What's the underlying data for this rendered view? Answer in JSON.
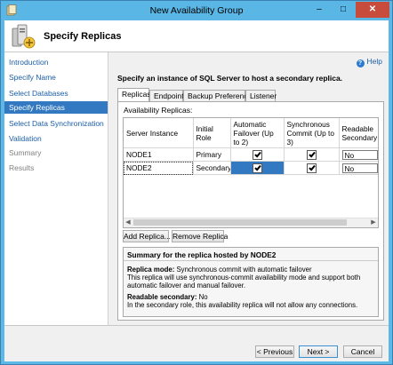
{
  "window": {
    "title": "New Availability Group",
    "minimize": "–",
    "maximize": "□",
    "close": "✕"
  },
  "header": {
    "title": "Specify Replicas"
  },
  "nav": {
    "items": [
      {
        "label": "Introduction",
        "state": "link"
      },
      {
        "label": "Specify Name",
        "state": "link"
      },
      {
        "label": "Select Databases",
        "state": "link"
      },
      {
        "label": "Specify Replicas",
        "state": "selected"
      },
      {
        "label": "Select Data Synchronization",
        "state": "link"
      },
      {
        "label": "Validation",
        "state": "link"
      },
      {
        "label": "Summary",
        "state": "disabled"
      },
      {
        "label": "Results",
        "state": "disabled"
      }
    ]
  },
  "content": {
    "help_label": "Help",
    "instruction": "Specify an instance of SQL Server to host a secondary replica.",
    "tabs": [
      "Replicas",
      "Endpoints",
      "Backup Preferences",
      "Listener"
    ],
    "active_tab": "Replicas",
    "panel_label": "Availability Replicas:",
    "table": {
      "headers": [
        "Server Instance",
        "Initial Role",
        "Automatic Failover (Up to 2)",
        "Synchronous Commit (Up to 3)",
        "Readable Secondary"
      ],
      "rows": [
        {
          "server": "NODE1",
          "role": "Primary",
          "auto_failover": true,
          "sync_commit": true,
          "readable": "No"
        },
        {
          "server": "NODE2",
          "role": "Secondary",
          "auto_failover": true,
          "sync_commit": true,
          "readable": "No"
        }
      ],
      "selected_row": 1
    },
    "buttons": {
      "add_replica": "Add Replica...",
      "remove_replica": "Remove Replica"
    },
    "summary": {
      "title": "Summary for the replica hosted by NODE2",
      "replica_mode_label": "Replica mode:",
      "replica_mode_value": "Synchronous commit with automatic failover",
      "replica_mode_desc": "This replica will use synchronous-commit availability mode and support both automatic failover and manual failover.",
      "readable_label": "Readable secondary:",
      "readable_value": "No",
      "readable_desc": "In the secondary role, this availability replica will not allow any connections."
    }
  },
  "footer": {
    "previous": "< Previous",
    "next": "Next >",
    "cancel": "Cancel"
  },
  "colors": {
    "title_bar": "#5ab6e4",
    "selection": "#3279c2",
    "close_button": "#c74c3c",
    "link": "#1a5ea8"
  }
}
